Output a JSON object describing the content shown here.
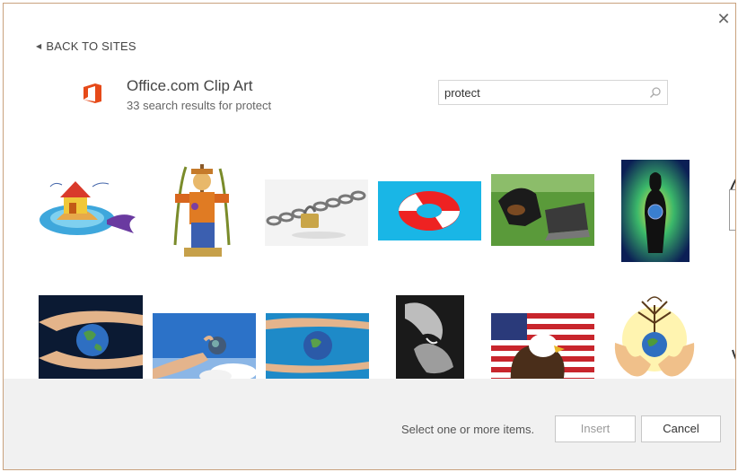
{
  "dialog": {
    "close_glyph": "✕",
    "back_label": "BACK TO SITES",
    "provider_title": "Office.com Clip Art",
    "results_text": "33 search results for protect",
    "search": {
      "value": "protect",
      "placeholder": ""
    },
    "brand_color": "#e64a19"
  },
  "thumbnails": [
    {
      "name": "house-island-clipart"
    },
    {
      "name": "scarecrow-clipart"
    },
    {
      "name": "chain-padlock-photo"
    },
    {
      "name": "life-ring-photo"
    },
    {
      "name": "dog-laptop-photo"
    },
    {
      "name": "woman-globe-photo"
    },
    {
      "name": "hands-earth-photo"
    },
    {
      "name": "hand-holding-globe-photo"
    },
    {
      "name": "hands-around-earth-photo"
    },
    {
      "name": "hands-bw-photo"
    },
    {
      "name": "eagle-flag-photo"
    },
    {
      "name": "tree-globe-hands-clipart"
    }
  ],
  "footer": {
    "hint": "Select one or more items.",
    "insert_label": "Insert",
    "cancel_label": "Cancel"
  }
}
